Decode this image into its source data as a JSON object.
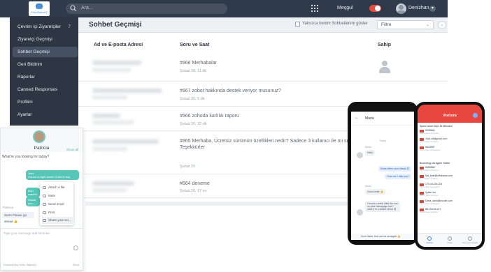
{
  "app": {
    "logo_text": "ZohoSalesIQ",
    "search_placeholder": "Ara...",
    "status_label": "Meşgul",
    "user_name": "Denizhan"
  },
  "sidebar": {
    "items": [
      {
        "label": "Çevrim içi Ziyaretçiler",
        "count": "7"
      },
      {
        "label": "Ziyaretçi Geçmişi"
      },
      {
        "label": "Sohbet Geçmişi"
      },
      {
        "label": "Geri Bildirim"
      },
      {
        "label": "Raporlar"
      },
      {
        "label": "Canned Responses"
      },
      {
        "label": "Profilim"
      },
      {
        "label": "Ayarlar"
      }
    ]
  },
  "main": {
    "title": "Sohbet Geçmişi",
    "only_mine_label": "Yalnızca benim Sohbetlerimi göster",
    "filter_value": "Filtre",
    "columns": {
      "name": "Ad ve E-posta Adresi",
      "question": "Soru ve Saat",
      "owner": "Sahip"
    },
    "rows": [
      {
        "question": "#668 Merhabalar",
        "meta": "Şubat 28, 11 dk"
      },
      {
        "question": "#667 zobot hakkında destek veriyor musunuz?",
        "meta": "Şubat 26, 5 dk"
      },
      {
        "question": "#666 zohoda karlılık raporu",
        "meta": "Şubat 26, 32 dk"
      },
      {
        "question": "#665 Merhaba, Ücretsiz sürümün özellikleri nedir? Sadece 3 kullanıcı ile mi sınırlı? Teşekkürler",
        "meta": "Şubat 25"
      },
      {
        "question": "#664 deneme",
        "meta": "Şubat 20, 17 sn"
      }
    ]
  },
  "widget": {
    "agent_name": "Patricia",
    "show_all": "Show all",
    "question": "What're you looking for today?",
    "bubble1_sender": "Jean",
    "bubble1": "I found a night stand i'd like to buy",
    "bubble2": "But I wanted...",
    "bubble3": "Would you...",
    "menu": [
      "Attach a file",
      "Mute",
      "Send email",
      "Print",
      "Share your scr..."
    ],
    "agent_label": "Patricia",
    "agent_reply": "Sure! Please go ahead 👍",
    "input_placeholder": "Type your message and hit Enter",
    "footer": "Powered by Zoho SalesIQ",
    "send": "Send"
  },
  "phone_android": {
    "contact": "Maria",
    "day": "Today",
    "in1_sender": "Maria",
    "in1": "Hello",
    "out1": "Great offers soon Maria 😊",
    "out2": "How can I help you?",
    "in2_sender": "Maria",
    "in2": "Good order 👍",
    "in3": "I found a chest I like the one on your homepage but I want it in a darker finish 😊",
    "compose": "Sure Maria, that can be arranged 👍"
  },
  "phone_ios": {
    "title": "Visitors",
    "section1": "Spent more than 10 Minutes",
    "section2": "Browsing via Apple Safari",
    "visitors": [
      {
        "name": "9045664",
        "sub": "https://zylker.com/pricing"
      },
      {
        "name": "Jack.zd@gmail.com",
        "sub": "https://zylker.com/home"
      },
      {
        "name": "9643987",
        "sub": "https://zylker.com/features"
      },
      {
        "name": "5655568",
        "sub": "https://zylker.com/pricing"
      },
      {
        "name": "Sal_kate@offslowas.com",
        "sub": "https://zylker.com/home"
      },
      {
        "name": "170.40.234.224",
        "sub": "https://zylker.com/contact"
      },
      {
        "name": "Zylker Inc",
        "sub": "https://zylker.com/home"
      },
      {
        "name": "Dana_david@zoolie.com",
        "sub": "https://zylker.com/pricing"
      },
      {
        "name": "88.234.65.147",
        "sub": "https://zylker.com/home"
      }
    ],
    "tabs": [
      "Visitors",
      "Chats",
      "Operators Online"
    ]
  },
  "colors": {
    "topbar": "#2f3a4b",
    "sidebar": "#2d3744",
    "accent_teal": "#56c6b9",
    "busy_red": "#e74c3c",
    "ios_header": "#e8473f"
  }
}
